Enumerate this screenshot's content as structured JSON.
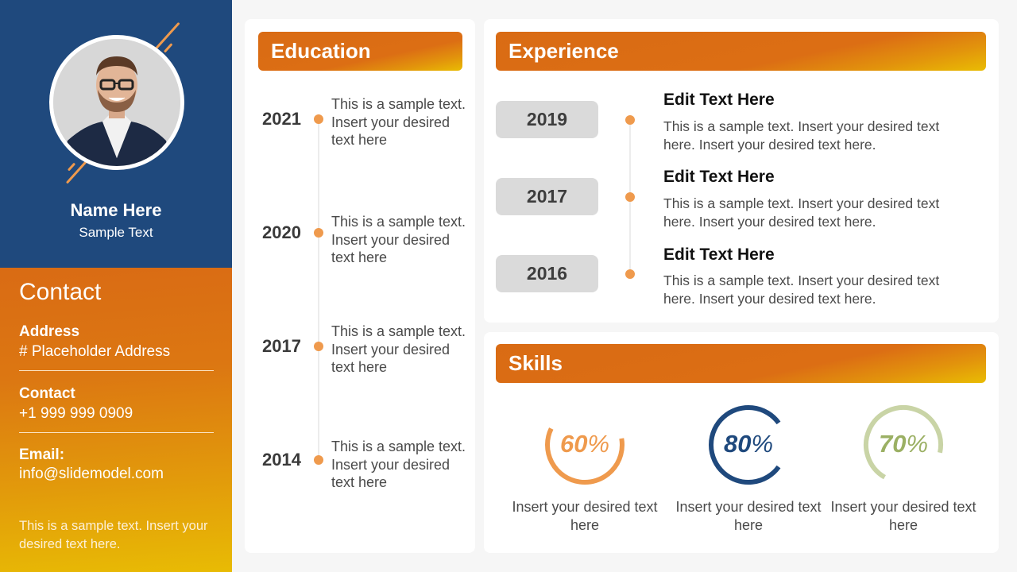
{
  "profile": {
    "name": "Name Here",
    "subtitle": "Sample Text",
    "avatar": "profile-photo"
  },
  "contact": {
    "title": "Contact",
    "items": [
      {
        "label": "Address",
        "value": "# Placeholder  Address"
      },
      {
        "label": "Contact",
        "value": "+1 999 999 0909"
      },
      {
        "label": "Email:",
        "value": "info@slidemodel.com"
      }
    ],
    "note": "This is a sample text. Insert your desired text here."
  },
  "education": {
    "title": "Education",
    "items": [
      {
        "year": "2021",
        "text": "This is a sample text. Insert your desired text here"
      },
      {
        "year": "2020",
        "text": "This is a sample text. Insert your desired text here"
      },
      {
        "year": "2017",
        "text": "This is a sample text. Insert your desired text here"
      },
      {
        "year": "2014",
        "text": "This is a sample text. Insert your desired text here"
      }
    ]
  },
  "experience": {
    "title": "Experience",
    "items": [
      {
        "year": "2019",
        "heading": "Edit Text Here",
        "text": "This is a sample text. Insert your desired text here. Insert your desired text here."
      },
      {
        "year": "2017",
        "heading": "Edit Text Here",
        "text": "This is a sample text. Insert your desired text here. Insert your desired text here."
      },
      {
        "year": "2016",
        "heading": "Edit Text Here",
        "text": "This is a sample text. Insert your desired text here. Insert your desired text here."
      }
    ]
  },
  "skills": {
    "title": "Skills",
    "items": [
      {
        "value": 60,
        "number": "60",
        "unit": "%",
        "color": "#ef9a4d",
        "text": "Insert your desired text here"
      },
      {
        "value": 80,
        "number": "80",
        "unit": "%",
        "color": "#1f497d",
        "text": "Insert your desired text here"
      },
      {
        "value": 70,
        "number": "70",
        "unit": "%",
        "color": "#c9d4a6",
        "text_color": "#9bb064",
        "text": "Insert your desired text here"
      }
    ]
  },
  "colors": {
    "navy": "#1f497d",
    "orange": "#d96b14",
    "accent_orange": "#ef9a4d",
    "gold": "#e8bb04",
    "chip_gray": "#dadada"
  }
}
